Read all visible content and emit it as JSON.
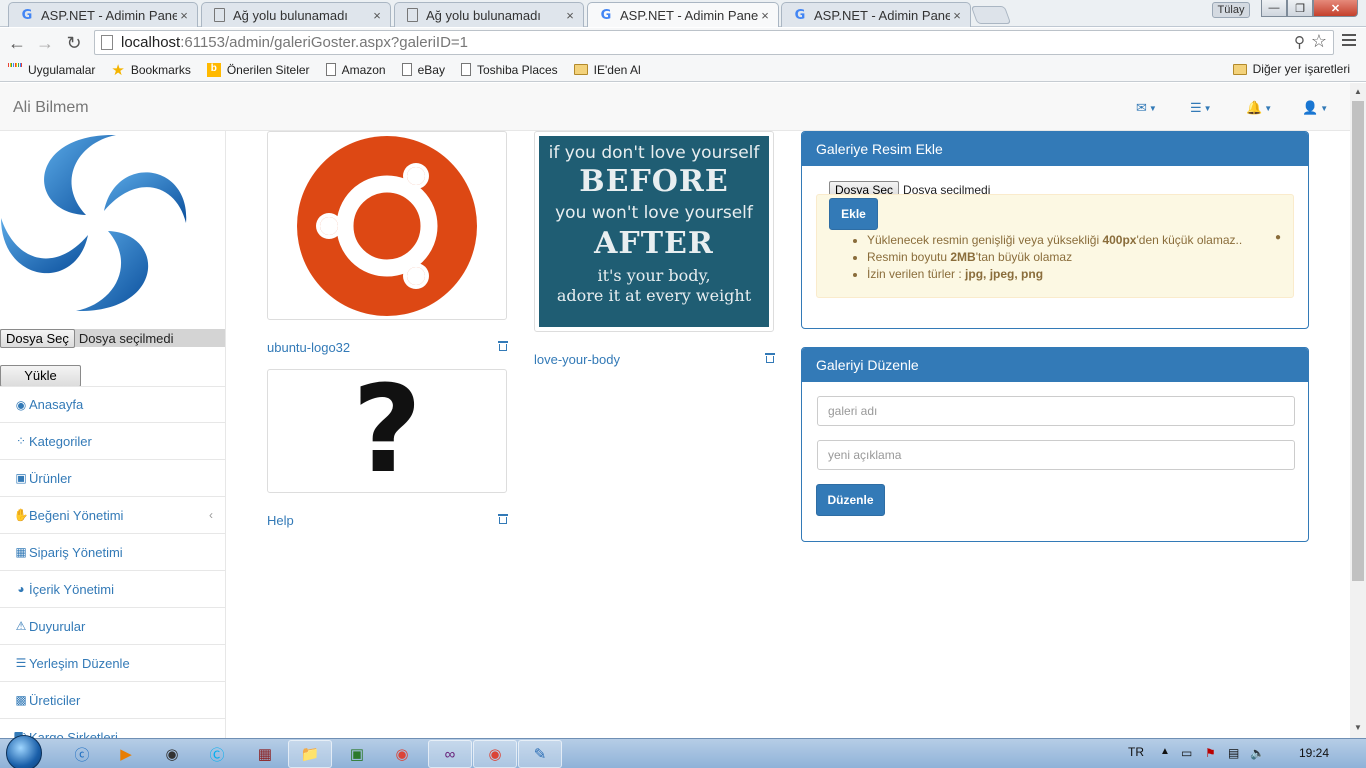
{
  "browser": {
    "tabs": [
      {
        "title": "ASP.NET - Adimin Panel",
        "icon": "google-icon"
      },
      {
        "title": "Ağ yolu bulunamadı",
        "icon": "page-icon"
      },
      {
        "title": "Ağ yolu bulunamadı",
        "icon": "page-icon"
      },
      {
        "title": "ASP.NET - Adimin Panel",
        "icon": "google-icon",
        "active": true
      },
      {
        "title": "ASP.NET - Adimin Panel",
        "icon": "google-icon"
      }
    ],
    "close_glyph": "×",
    "user": "Tülay",
    "window_buttons": {
      "minimize": "—",
      "maximize": "❐",
      "close": "✕"
    },
    "url_host": "localhost",
    "url_rest": ":61153/admin/galeriGoster.aspx?galeriID=1",
    "bookmarks": [
      "Uygulamalar",
      "Bookmarks",
      "Önerilen Siteler",
      "Amazon",
      "eBay",
      "Toshiba Places",
      "IE'den Al"
    ],
    "bookmarks_other": "Diğer yer işaretleri"
  },
  "app": {
    "brand": "Ali Bilmem",
    "sidebar": {
      "file_button": "Dosya Seç",
      "file_status": "Dosya seçilmedi",
      "upload_button": "Yükle",
      "menu": [
        {
          "label": "Anasayfa",
          "icon": "dashboard-icon"
        },
        {
          "label": "Kategoriler",
          "icon": "spinner-icon"
        },
        {
          "label": "Ürünler",
          "icon": "cart-icon"
        },
        {
          "label": "Beğeni Yönetimi",
          "icon": "thumbs-up-icon",
          "has_submenu": true
        },
        {
          "label": "Sipariş Yönetimi",
          "icon": "gift-icon"
        },
        {
          "label": "İçerik Yönetimi",
          "icon": "pie-chart-icon"
        },
        {
          "label": "Duyurular",
          "icon": "warning-icon"
        },
        {
          "label": "Yerleşim Düzenle",
          "icon": "list-icon"
        },
        {
          "label": "Üreticiler",
          "icon": "building-icon"
        },
        {
          "label": "Kargo Şirketleri",
          "icon": "truck-icon"
        }
      ]
    },
    "gallery": [
      {
        "caption": "ubuntu-logo32"
      },
      {
        "caption": "love-your-body",
        "poster_lines": [
          "if you don't love yourself",
          "BEFORE",
          "you won't love yourself",
          "AFTER",
          "it's your body,",
          "adore it at every weight"
        ]
      },
      {
        "caption": "Help",
        "glyph": "?"
      }
    ],
    "add_panel": {
      "title": "Galeriye Resim Ekle",
      "file_button": "Dosya Seç",
      "file_status": "Dosya seçilmedi",
      "submit": "Ekle",
      "rules": [
        {
          "pre": "Yüklenecek resmin genişliği veya yüksekliği ",
          "bold": "400px",
          "post": "'den küçük olamaz.."
        },
        {
          "pre": "Resmin boyutu ",
          "bold": "2MB",
          "post": "'tan büyük olamaz"
        },
        {
          "pre": "İzin verilen türler : ",
          "bold": "jpg, jpeg, png",
          "post": ""
        }
      ]
    },
    "edit_panel": {
      "title": "Galeriyi Düzenle",
      "name_placeholder": "galeri adı",
      "desc_placeholder": "yeni açıklama",
      "submit": "Düzenle"
    }
  },
  "taskbar": {
    "lang": "TR",
    "time": "19:24"
  },
  "colors": {
    "primary": "#337ab7",
    "alert_bg": "#fcf8e3",
    "ubuntu": "#dd4814",
    "poster_bg": "#1f5d73"
  }
}
